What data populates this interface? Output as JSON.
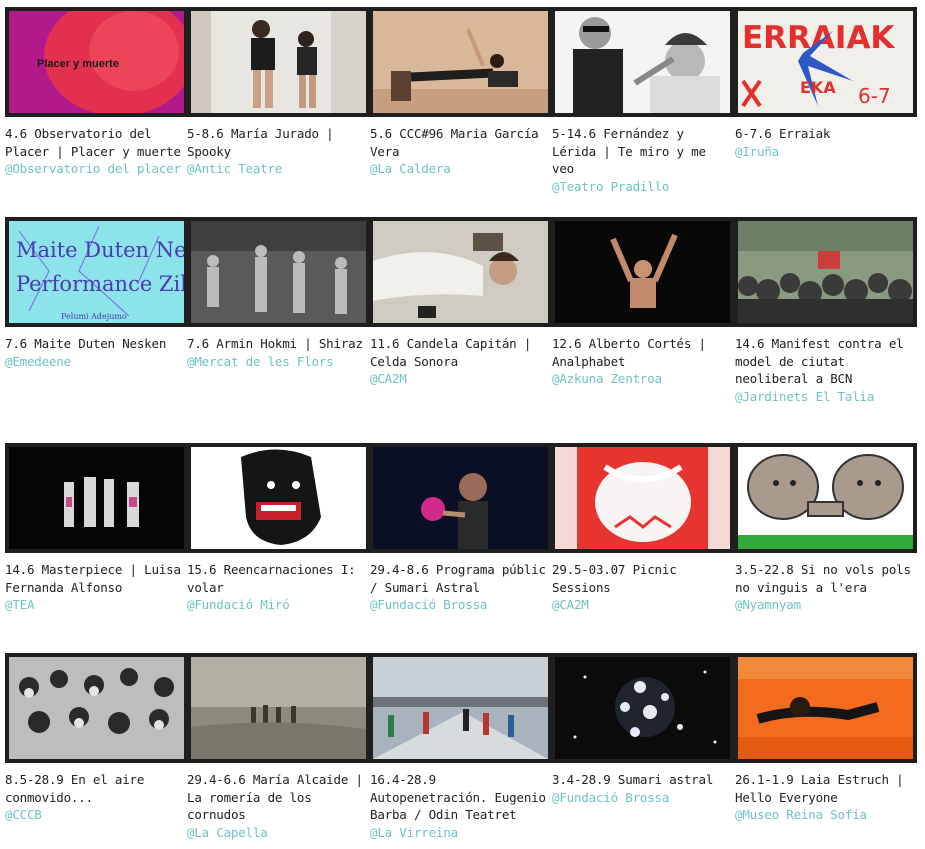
{
  "rows": [
    {
      "items": [
        {
          "title": "4.6 Observatorio del Placer | Placer y muerte",
          "venue": "@Observatorio del placer",
          "thumb_text": "Placer y muerte"
        },
        {
          "title": "5-8.6 María Jurado | Spooky",
          "venue": "@Antic Teatre"
        },
        {
          "title": "5.6 CCC#96 Maria García Vera",
          "venue": "@La Caldera"
        },
        {
          "title": "5-14.6 Fernández y Lérida | Te miro y me veo",
          "venue": "@Teatro Pradillo"
        },
        {
          "title": "6-7.6 Erraiak",
          "venue": "@Iruña",
          "thumb_text": "ERRAIAK",
          "thumb_sub": "EKA",
          "thumb_date": "6-7"
        }
      ]
    },
    {
      "items": [
        {
          "title": "7.6 Maite Duten Nesken",
          "venue": "@Emedeene",
          "thumb_line1": "Maite Duten Nesken",
          "thumb_line2": "Performance Zikloa",
          "thumb_credit": "Pelumi Adejumo"
        },
        {
          "title": "7.6 Armin Hokmi | Shiraz",
          "venue": "@Mercat de les Flors"
        },
        {
          "title": "11.6 Candela Capitán | Celda Sonora",
          "venue": "@CA2M"
        },
        {
          "title": "12.6 Alberto Cortés | Analphabet",
          "venue": "@Azkuna Zentroa"
        },
        {
          "title": "14.6 Manifest contra el model de ciutat neoliberal a BCN",
          "venue": "@Jardinets El Talia"
        }
      ]
    },
    {
      "items": [
        {
          "title": "14.6 Masterpiece | Luisa Fernanda Alfonso",
          "venue": "@TEA"
        },
        {
          "title": "15.6 Reencarnaciones I: volar",
          "venue": "@Fundació Miró"
        },
        {
          "title": "29.4-8.6 Programa públic / Sumari Astral",
          "venue": "@Fundació Brossa"
        },
        {
          "title": "29.5-03.07 Picnic Sessions",
          "venue": "@CA2M"
        },
        {
          "title": "3.5-22.8 Si no vols pols no vinguis a l'era",
          "venue": "@Nyamnyam"
        }
      ]
    },
    {
      "items": [
        {
          "title": "8.5-28.9 En el aire conmovido...",
          "venue": "@CCCB"
        },
        {
          "title": "29.4-6.6 María Alcaide | La romería de los cornudos",
          "venue": "@La Capella"
        },
        {
          "title": "16.4-28.9 Autopenetración. Eugenio Barba / Odin Teatret",
          "venue": "@La Virreina"
        },
        {
          "title": "3.4-28.9 Sumari astral",
          "venue": "@Fundació Brossa"
        },
        {
          "title": "26.1-1.9 Laia Estruch | Hello Everyone",
          "venue": "@Museo Reina Sofía"
        }
      ]
    }
  ]
}
